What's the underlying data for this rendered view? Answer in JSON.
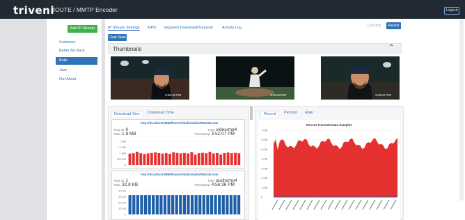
{
  "header": {
    "logo": "triveni",
    "app_title": "ROUTE / MMTP Encoder",
    "logout": "Logout"
  },
  "sidebar": {
    "add_stream": "Add IP Stream",
    "items": [
      {
        "label": "Summary",
        "active": false
      },
      {
        "label": "Better Be Back",
        "active": false
      },
      {
        "label": "Bulls",
        "active": true
      },
      {
        "label": "Jazz",
        "active": false
      },
      {
        "label": "Out About",
        "active": false
      }
    ]
  },
  "tabs": [
    "IP Stream Settings",
    "MPD",
    "Segment Download/Transmit",
    "Activity Log"
  ],
  "actions": {
    "commit": "Commit",
    "revert": "Revert",
    "clear_stats": "Clear Stats"
  },
  "thumbnails": {
    "title": "Thumbnails",
    "items": [
      {
        "time": "3:46:15 PM"
      },
      {
        "time": "3:46:23 PM"
      },
      {
        "time": "3:46:27 PM"
      }
    ]
  },
  "left_pane": {
    "tabs": [
      "Download Size",
      "Download Time"
    ],
    "video": {
      "url": "http://localhost:8888/livesim/bulls/video/555242.m4s",
      "rep_id_label": "Rep ID:",
      "rep_id": "0",
      "max_label": "Max:",
      "max": "1.8 MB",
      "type_label": "Type:",
      "type": "video/mp4",
      "timestamp_label": "Timestamp:",
      "timestamp": "3:52:07 PM",
      "axis": [
        "2 MB",
        "1.5 MB",
        "1 MB",
        "500 KB",
        "0"
      ],
      "bar_color": "#e53030"
    },
    "audio": {
      "url": "http://localhost:8888/livesim/bulls/audio/555242.m4s",
      "rep_id_label": "Rep ID:",
      "rep_id": "1",
      "max_label": "Max:",
      "max": "32.8 KB",
      "type_label": "Type:",
      "type": "audio/mp4",
      "timestamp_label": "Timestamp:",
      "timestamp": "4:56:36 PM",
      "axis": [
        "40 KB",
        "30 KB",
        "20 KB",
        "10 KB",
        "0"
      ],
      "bar_color": "#1d5fa8"
    }
  },
  "right_pane": {
    "tabs": [
      "Recent",
      "Percent",
      "Rate"
    ],
    "chart_title": "Recent Transmit Data Samples",
    "axis": [
      "7 MB",
      "6 MB",
      "5 MB",
      "4 MB",
      "3 MB",
      "2 MB",
      "1 MB",
      "0"
    ],
    "area_color": "#e53030"
  }
}
